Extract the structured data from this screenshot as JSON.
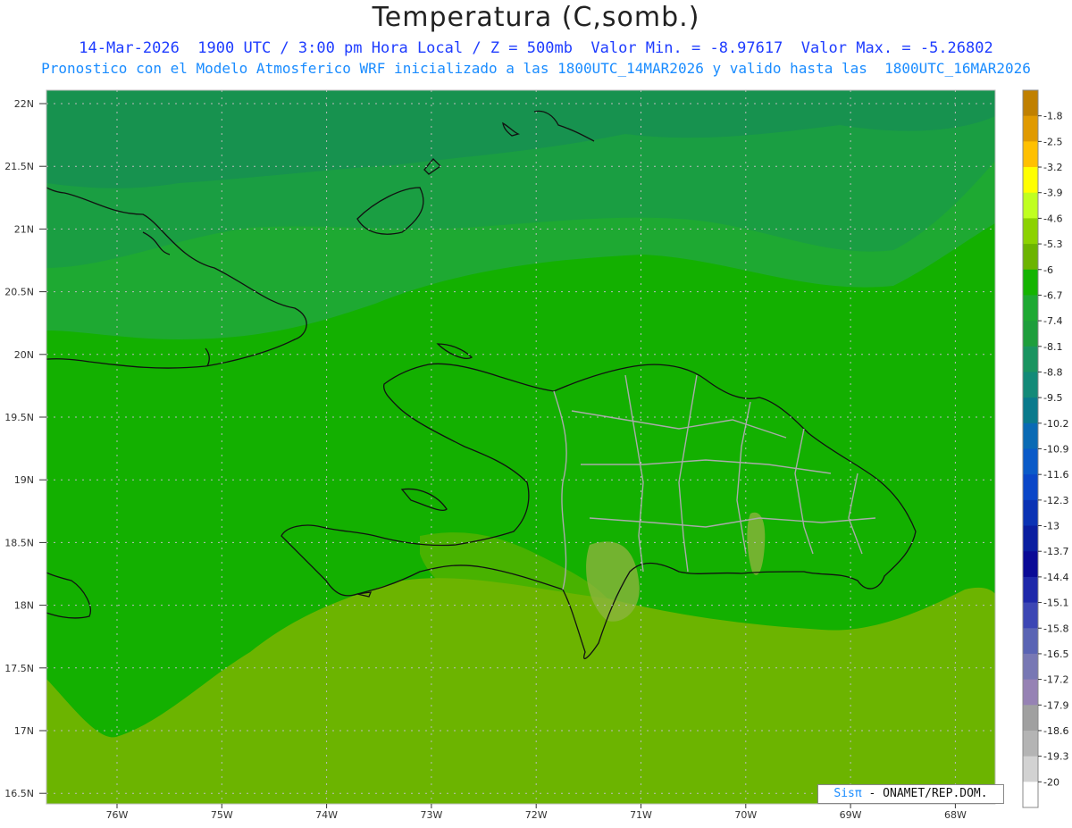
{
  "title": "Temperatura (C,somb.)",
  "subtitle_line1": "14-Mar-2026  1900 UTC / 3:00 pm Hora Local / Z = 500mb  Valor Min. = -8.97617  Valor Max. = -5.26802",
  "subtitle_line2": "Pronostico con el Modelo Atmosferico WRF inicializado a las 1800UTC_14MAR2026 y valido hasta las  1800UTC_16MAR2026",
  "lat_labels": [
    "22N",
    "21.5N",
    "21N",
    "20.5N",
    "20N",
    "19.5N",
    "19N",
    "18.5N",
    "18N",
    "17.5N",
    "17N",
    "16.5N"
  ],
  "lon_labels": [
    "76W",
    "75W",
    "74W",
    "73W",
    "72W",
    "71W",
    "70W",
    "69W",
    "68W"
  ],
  "legend": {
    "labels": [
      "-1.8",
      "-2.5",
      "-3.2",
      "-3.9",
      "-4.6",
      "-5.3",
      "-6",
      "-6.7",
      "-7.4",
      "-8.1",
      "-8.8",
      "-9.5",
      "-10.2",
      "-10.9",
      "-11.6",
      "-12.3",
      "-13",
      "-13.7",
      "-14.4",
      "-15.1",
      "-15.8",
      "-16.5",
      "-17.2",
      "-17.9",
      "-18.6",
      "-19.3",
      "-20"
    ],
    "colors": [
      "#c08000",
      "#e09a00",
      "#ffc000",
      "#ffff00",
      "#c0ff20",
      "#8cd200",
      "#6cb400",
      "#14b400",
      "#1ea932",
      "#1e9e3c",
      "#1a9460",
      "#138a78",
      "#0a7a8c",
      "#0a6ab4",
      "#0a5ac8",
      "#0a46c8",
      "#0a32b4",
      "#0a1ea0",
      "#0a0a96",
      "#1e28aa",
      "#3c46b4",
      "#5a64b4",
      "#7878b4",
      "#9682b4",
      "#a0a0a0",
      "#b4b4b4",
      "#d2d2d2",
      "#ffffff"
    ]
  },
  "credit": {
    "brand": "Sisπ",
    "org": "- ONAMET/REP.DOM."
  }
}
